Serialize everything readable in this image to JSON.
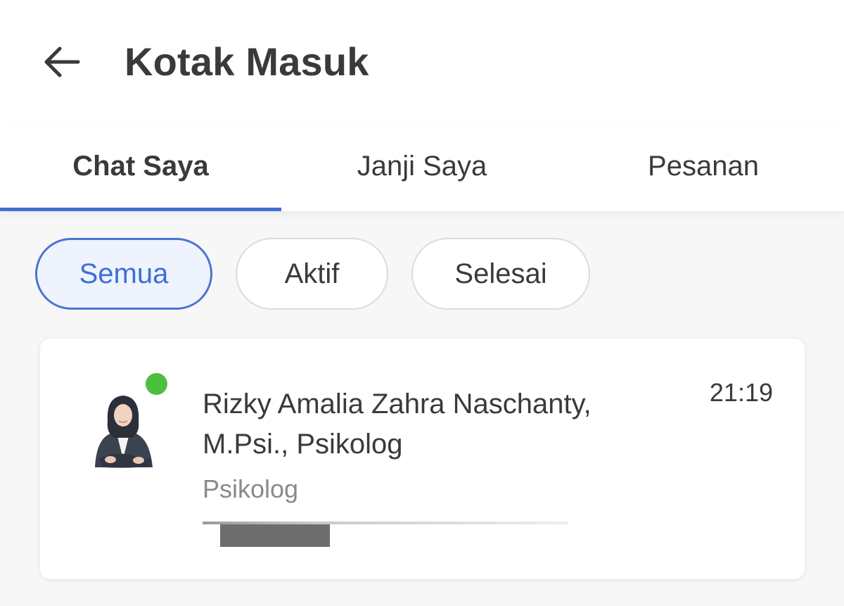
{
  "header": {
    "title": "Kotak Masuk",
    "back_icon": "arrow-left-icon"
  },
  "tabs": [
    {
      "label": "Chat Saya",
      "active": true
    },
    {
      "label": "Janji Saya",
      "active": false
    },
    {
      "label": "Pesanan",
      "active": false
    }
  ],
  "filters": [
    {
      "label": "Semua",
      "selected": true
    },
    {
      "label": "Aktif",
      "selected": false
    },
    {
      "label": "Selesai",
      "selected": false
    }
  ],
  "chats": [
    {
      "name": "Rizky Amalia Zahra Naschanty, M.Psi., Psikolog",
      "role": "Psikolog",
      "time": "21:19",
      "online": true
    }
  ],
  "colors": {
    "accent": "#3d6fd6",
    "online": "#4cbf3f",
    "selected_chip_bg": "#eef3fd"
  }
}
